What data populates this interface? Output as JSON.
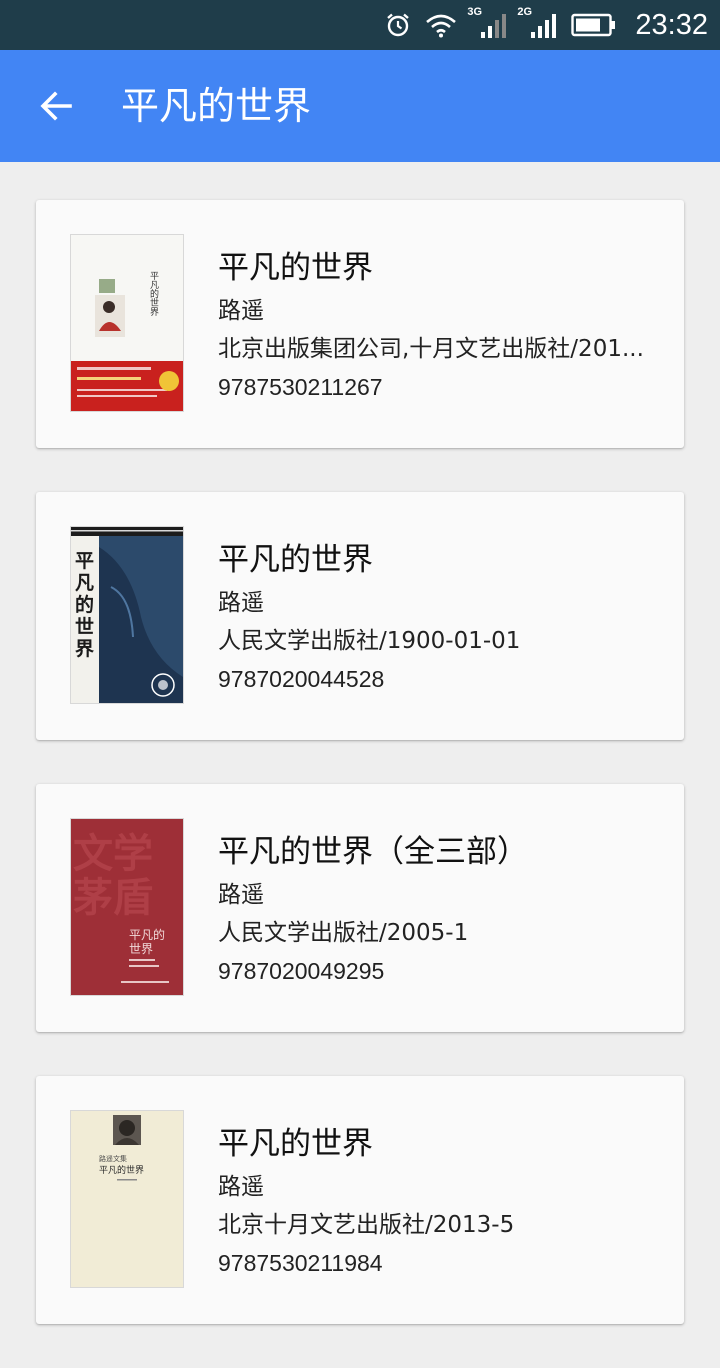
{
  "status_bar": {
    "time": "23:32",
    "network_1": "3G",
    "network_2": "2G",
    "icons": [
      "alarm-icon",
      "wifi-icon",
      "signal-3g-icon",
      "signal-2g-icon",
      "battery-icon"
    ]
  },
  "app_bar": {
    "title": "平凡的世界",
    "back_icon": "arrow-back-icon",
    "color": "#4285f4"
  },
  "books": [
    {
      "title": "平凡的世界",
      "author": "路遥",
      "publisher": "北京出版集团公司,十月文艺出版社/201...",
      "isbn": "9787530211267"
    },
    {
      "title": "平凡的世界",
      "author": "路遥",
      "publisher": "人民文学出版社/1900-01-01",
      "isbn": "9787020044528"
    },
    {
      "title": "平凡的世界（全三部）",
      "author": "路遥",
      "publisher": "人民文学出版社/2005-1",
      "isbn": "9787020049295"
    },
    {
      "title": "平凡的世界",
      "author": "路遥",
      "publisher": "北京十月文艺出版社/2013-5",
      "isbn": "9787530211984"
    }
  ]
}
